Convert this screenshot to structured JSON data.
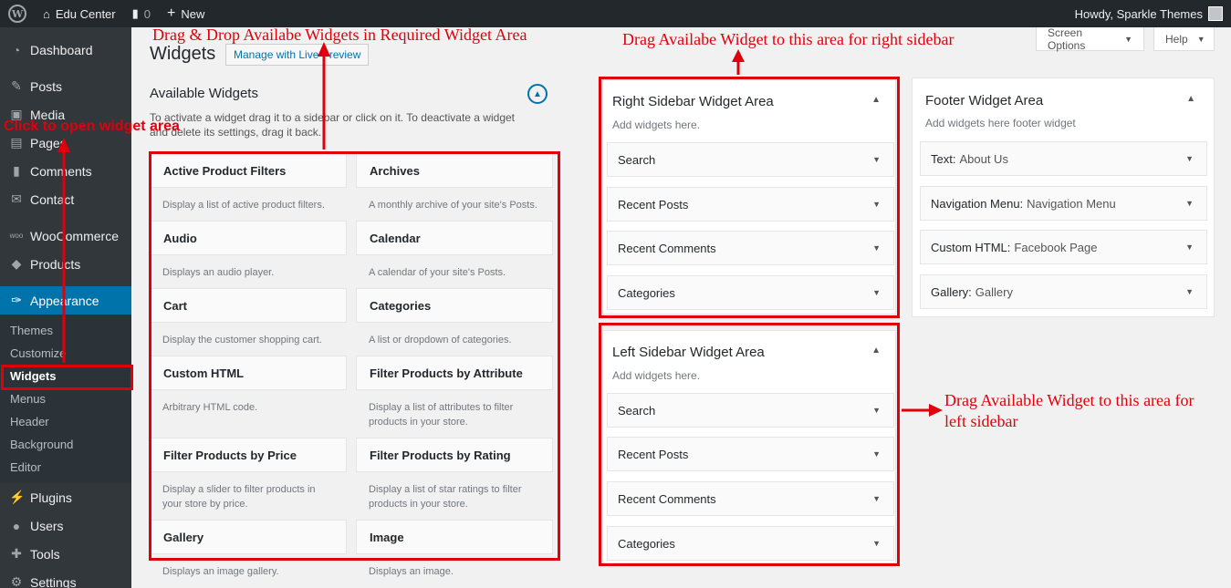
{
  "adminbar": {
    "site_name": "Edu Center",
    "comments_count": "0",
    "new_label": "New",
    "howdy": "Howdy, Sparkle Themes"
  },
  "sidebar": {
    "items": [
      {
        "label": "Dashboard",
        "icon": "dashboard-icon"
      },
      {
        "label": "Posts",
        "icon": "pin-icon"
      },
      {
        "label": "Media",
        "icon": "media-icon"
      },
      {
        "label": "Pages",
        "icon": "pages-icon"
      },
      {
        "label": "Comments",
        "icon": "comment-icon"
      },
      {
        "label": "Contact",
        "icon": "mail-icon"
      },
      {
        "label": "WooCommerce",
        "icon": "woo-icon"
      },
      {
        "label": "Products",
        "icon": "box-icon"
      },
      {
        "label": "Appearance",
        "icon": "brush-icon"
      }
    ],
    "submenu": [
      "Themes",
      "Customize",
      "Widgets",
      "Menus",
      "Header",
      "Background",
      "Editor"
    ],
    "items_after": [
      {
        "label": "Plugins",
        "icon": "plugin-icon"
      },
      {
        "label": "Users",
        "icon": "user-icon"
      },
      {
        "label": "Tools",
        "icon": "wrench-icon"
      },
      {
        "label": "Settings",
        "icon": "settings-icon"
      }
    ]
  },
  "header": {
    "title": "Widgets",
    "manage_button": "Manage with Live Preview",
    "screen_options": "Screen Options",
    "help": "Help"
  },
  "available": {
    "title": "Available Widgets",
    "description": "To activate a widget drag it to a sidebar or click on it. To deactivate a widget and delete its settings, drag it back.",
    "widgets": [
      {
        "name": "Active Product Filters",
        "desc": "Display a list of active product filters."
      },
      {
        "name": "Archives",
        "desc": "A monthly archive of your site's Posts."
      },
      {
        "name": "Audio",
        "desc": "Displays an audio player."
      },
      {
        "name": "Calendar",
        "desc": "A calendar of your site's Posts."
      },
      {
        "name": "Cart",
        "desc": "Display the customer shopping cart."
      },
      {
        "name": "Categories",
        "desc": "A list or dropdown of categories."
      },
      {
        "name": "Custom HTML",
        "desc": "Arbitrary HTML code."
      },
      {
        "name": "Filter Products by Attribute",
        "desc": "Display a list of attributes to filter products in your store."
      },
      {
        "name": "Filter Products by Price",
        "desc": "Display a slider to filter products in your store by price."
      },
      {
        "name": "Filter Products by Rating",
        "desc": "Display a list of star ratings to filter products in your store."
      },
      {
        "name": "Gallery",
        "desc": "Displays an image gallery."
      },
      {
        "name": "Image",
        "desc": "Displays an image."
      }
    ]
  },
  "right_sidebar": {
    "title": "Right Sidebar Widget Area",
    "desc": "Add widgets here.",
    "widgets": [
      "Search",
      "Recent Posts",
      "Recent Comments",
      "Categories"
    ]
  },
  "left_sidebar": {
    "title": "Left Sidebar Widget Area",
    "desc": "Add widgets here.",
    "widgets": [
      "Search",
      "Recent Posts",
      "Recent Comments",
      "Categories"
    ]
  },
  "footer_area": {
    "title": "Footer Widget Area",
    "desc": "Add widgets here footer widget",
    "widgets": [
      {
        "name": "Text:",
        "title": "About Us"
      },
      {
        "name": "Navigation Menu:",
        "title": "Navigation Menu"
      },
      {
        "name": "Custom HTML:",
        "title": "Facebook Page"
      },
      {
        "name": "Gallery:",
        "title": "Gallery"
      }
    ]
  },
  "annotations": {
    "drag_drop": "Drag & Drop Availabe Widgets in Required Widget Area",
    "right": "Drag Availabe Widget to this area for right sidebar",
    "left_line1": "Drag Available Widget to this area for",
    "left_line2": "left sidebar",
    "click": "Click to open widget area"
  },
  "colors": {
    "annotation_red": "#e0000b",
    "admin_bar": "#23282d",
    "menu_bg": "#32373c",
    "accent": "#0073aa"
  }
}
